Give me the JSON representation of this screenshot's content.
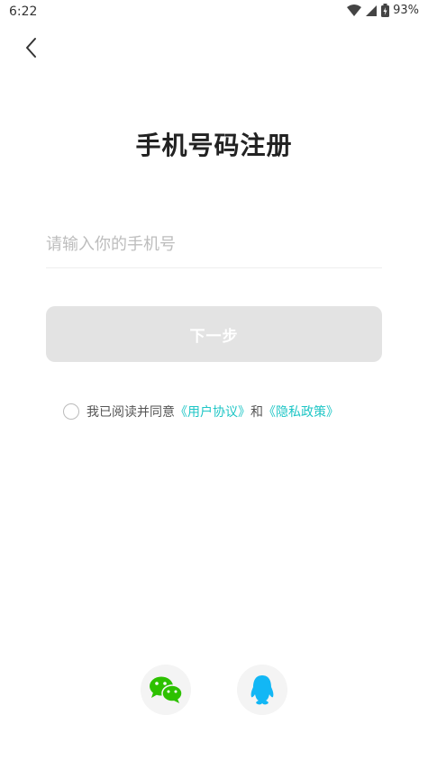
{
  "status_bar": {
    "time": "6:22",
    "battery": "93%"
  },
  "page": {
    "title": "手机号码注册"
  },
  "form": {
    "phone_placeholder": "请输入你的手机号",
    "phone_value": "",
    "next_label": "下一步"
  },
  "agreement": {
    "prefix": "我已阅读并同意",
    "user_agreement": "《用户协议》",
    "conjunction": "和",
    "privacy_policy": "《隐私政策》"
  },
  "colors": {
    "link": "#1fc6c6",
    "button_disabled": "#e3e3e3",
    "wechat": "#2dc100",
    "qq": "#12b7f5"
  },
  "icons": {
    "back": "chevron-left-icon",
    "wechat": "wechat-icon",
    "qq": "qq-icon"
  }
}
